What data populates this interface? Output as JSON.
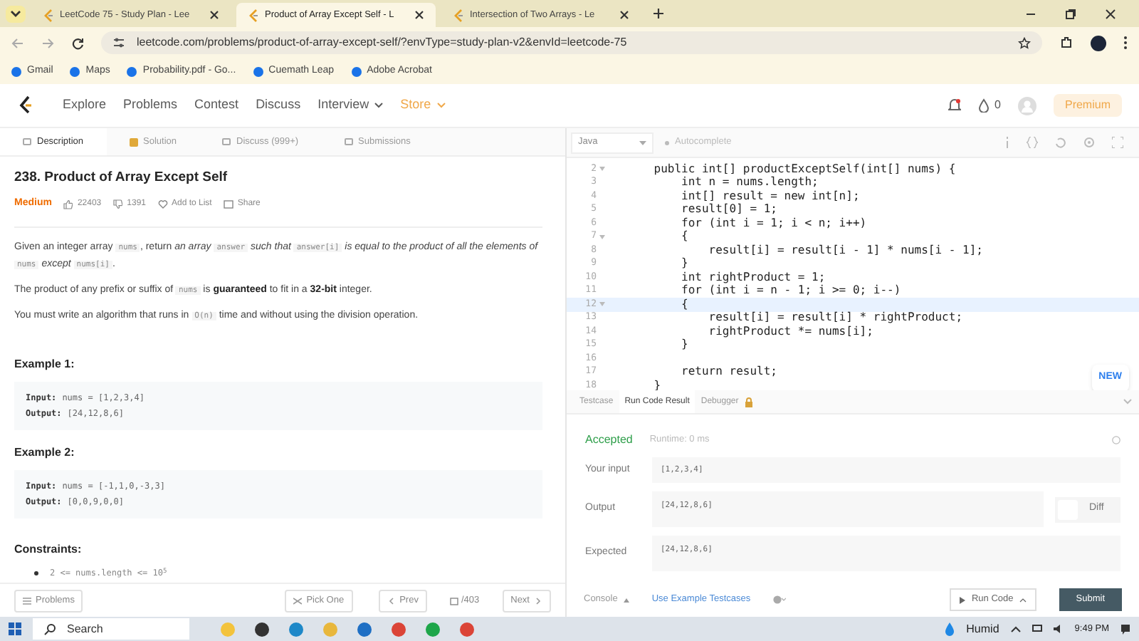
{
  "browser": {
    "tabs": [
      {
        "title": "LeetCode 75 - Study Plan - Lee",
        "selected": false
      },
      {
        "title": "Product of Array Except Self - L",
        "selected": true
      },
      {
        "title": "Intersection of Two Arrays - Le",
        "selected": false
      }
    ],
    "url": "leetcode.com/problems/product-of-array-except-self/?envType=study-plan-v2&envId=leetcode-75",
    "bookmarks": [
      "Gmail",
      "Maps",
      "Probability.pdf - Go...",
      "Cuemath Leap",
      "Adobe Acrobat"
    ]
  },
  "nav": {
    "items": [
      {
        "label": "Explore",
        "kind": "link"
      },
      {
        "label": "Problems",
        "kind": "link"
      },
      {
        "label": "Contest",
        "kind": "link"
      },
      {
        "label": "Discuss",
        "kind": "link"
      },
      {
        "label": "Interview",
        "kind": "menu"
      },
      {
        "label": "Store",
        "kind": "store"
      }
    ],
    "coins": "0",
    "premium": "Premium"
  },
  "description_tabs": [
    {
      "label": "Description",
      "selected": true
    },
    {
      "label": "Solution",
      "selected": false
    },
    {
      "label": "Discuss (999+)",
      "selected": false
    },
    {
      "label": "Submissions",
      "selected": false
    }
  ],
  "problem": {
    "title": "238. Product of Array Except Self",
    "difficulty": "Medium",
    "likes": "22403",
    "dislikes": "1391",
    "add_to_list": "Add to List",
    "share": "Share",
    "paragraphs": [
      [
        {
          "text": "Given an integer array ",
          "kind": "plain"
        },
        {
          "text": "nums",
          "kind": "code"
        },
        {
          "text": ", return ",
          "kind": "plain"
        },
        {
          "text": "an array ",
          "kind": "italic"
        },
        {
          "text": "answer",
          "kind": "code"
        },
        {
          "text": " such that ",
          "kind": "italic"
        },
        {
          "text": "answer[i]",
          "kind": "code"
        },
        {
          "text": " is equal to the product of all the elements of ",
          "kind": "italic"
        },
        {
          "text": "nums",
          "kind": "code"
        },
        {
          "text": " except ",
          "kind": "italic"
        },
        {
          "text": "nums[i]",
          "kind": "code"
        },
        {
          "text": ".",
          "kind": "plain"
        }
      ],
      [
        {
          "text": "The product of any prefix or suffix of ",
          "kind": "plain"
        },
        {
          "text": "nums",
          "kind": "code"
        },
        {
          "text": " is ",
          "kind": "plain"
        },
        {
          "text": "guaranteed",
          "kind": "bold"
        },
        {
          "text": " to fit in a ",
          "kind": "plain"
        },
        {
          "text": "32-bit",
          "kind": "bold"
        },
        {
          "text": " integer.",
          "kind": "plain"
        }
      ],
      [
        {
          "text": "You must write an algorithm that runs in ",
          "kind": "plain"
        },
        {
          "text": "O(n)",
          "kind": "code"
        },
        {
          "text": " time and without using the division operation.",
          "kind": "plain"
        }
      ]
    ],
    "examples": [
      {
        "title": "Example 1:",
        "input_label": "Input:",
        "input": "nums = [1,2,3,4]",
        "output_label": "Output:",
        "output": "[24,12,8,6]"
      },
      {
        "title": "Example 2:",
        "input_label": "Input:",
        "input": "nums = [-1,1,0,-3,3]",
        "output_label": "Output:",
        "output": "[0,0,9,0,0]"
      }
    ],
    "constraints_title": "Constraints:",
    "constraints": [
      "2 <= nums.length <= 10$^{5}$"
    ]
  },
  "left_footer": {
    "problems": "Problems",
    "pick_one": "Pick One",
    "prev": "Prev",
    "count": "/403",
    "next": "Next"
  },
  "editor": {
    "language": "Java",
    "autocomplete": "Autocomplete",
    "new_badge": "NEW",
    "lines": [
      {
        "number": "2",
        "fold": true,
        "current": false,
        "code": "    public int[] productExceptSelf(int[] nums) {"
      },
      {
        "number": "3",
        "fold": false,
        "current": false,
        "code": "        int n = nums.length;"
      },
      {
        "number": "4",
        "fold": false,
        "current": false,
        "code": "        int[] result = new int[n];"
      },
      {
        "number": "5",
        "fold": false,
        "current": false,
        "code": "        result[0] = 1;"
      },
      {
        "number": "6",
        "fold": false,
        "current": false,
        "code": "        for (int i = 1; i < n; i++)"
      },
      {
        "number": "7",
        "fold": true,
        "current": false,
        "code": "        {"
      },
      {
        "number": "8",
        "fold": false,
        "current": false,
        "code": "            result[i] = result[i - 1] * nums[i - 1];"
      },
      {
        "number": "9",
        "fold": false,
        "current": false,
        "code": "        }"
      },
      {
        "number": "10",
        "fold": false,
        "current": false,
        "code": "        int rightProduct = 1;"
      },
      {
        "number": "11",
        "fold": false,
        "current": false,
        "code": "        for (int i = n - 1; i >= 0; i--)"
      },
      {
        "number": "12",
        "fold": true,
        "current": true,
        "code": "        {"
      },
      {
        "number": "13",
        "fold": false,
        "current": false,
        "code": "            result[i] = result[i] * rightProduct;"
      },
      {
        "number": "14",
        "fold": false,
        "current": false,
        "code": "            rightProduct *= nums[i];"
      },
      {
        "number": "15",
        "fold": false,
        "current": false,
        "code": "        }"
      },
      {
        "number": "16",
        "fold": false,
        "current": false
      },
      {
        "number": "17",
        "fold": false,
        "current": false,
        "code": "        return result;"
      },
      {
        "number": "18",
        "fold": false,
        "current": false,
        "code": "    }"
      }
    ]
  },
  "result_tabs": [
    {
      "label": "Testcase",
      "selected": false
    },
    {
      "label": "Run Code Result",
      "selected": true
    },
    {
      "label": "Debugger",
      "selected": false
    }
  ],
  "result": {
    "status": "Accepted",
    "runtime": "Runtime: 0 ms",
    "rows": [
      {
        "label": "Your input",
        "value": "[1,2,3,4]"
      },
      {
        "label": "Output",
        "value": "[24,12,8,6]"
      },
      {
        "label": "Expected",
        "value": "[24,12,8,6]"
      }
    ],
    "diff": "Diff",
    "diff_on": false
  },
  "right_footer": {
    "console": "Console",
    "example_testcases": "Use Example Testcases",
    "run_code": "Run Code",
    "submit": "Submit"
  },
  "taskbar": {
    "search": "Search",
    "weather": "Humid",
    "time": "9:49 PM"
  }
}
